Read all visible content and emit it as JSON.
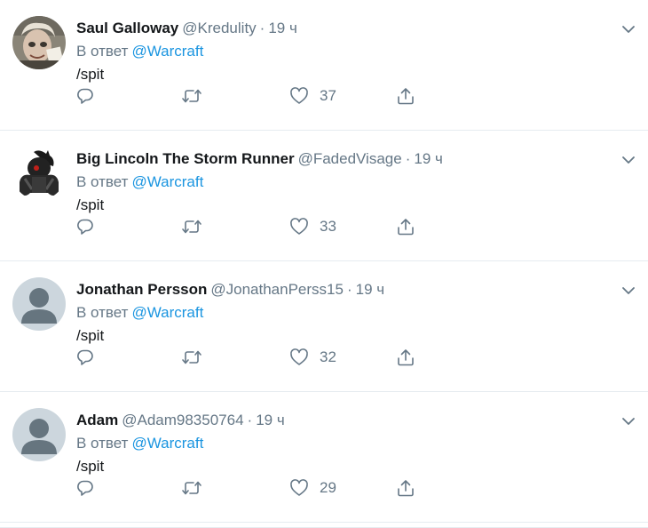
{
  "replying_prefix": "В ответ",
  "icons": {
    "reply": "reply-icon",
    "retweet": "retweet-icon",
    "like": "heart-icon",
    "share": "share-icon",
    "menu": "chevron-down-icon"
  },
  "colors": {
    "link": "#1b95e0",
    "secondary": "#657786",
    "divider": "#e6ecf0"
  },
  "tweets": [
    {
      "name": "Saul Galloway",
      "handle": "@Kredulity",
      "time": "19 ч",
      "mention": "@Warcraft",
      "text": "/spit",
      "likes": "37"
    },
    {
      "name": "Big Lincoln The Storm Runner",
      "handle": "@FadedVisage",
      "time": "19 ч",
      "mention": "@Warcraft",
      "text": "/spit",
      "likes": "33"
    },
    {
      "name": "Jonathan Persson",
      "handle": "@JonathanPerss15",
      "time": "19 ч",
      "mention": "@Warcraft",
      "text": "/spit",
      "likes": "32"
    },
    {
      "name": "Adam",
      "handle": "@Adam98350764",
      "time": "19 ч",
      "mention": "@Warcraft",
      "text": "/spit",
      "likes": "29"
    }
  ]
}
